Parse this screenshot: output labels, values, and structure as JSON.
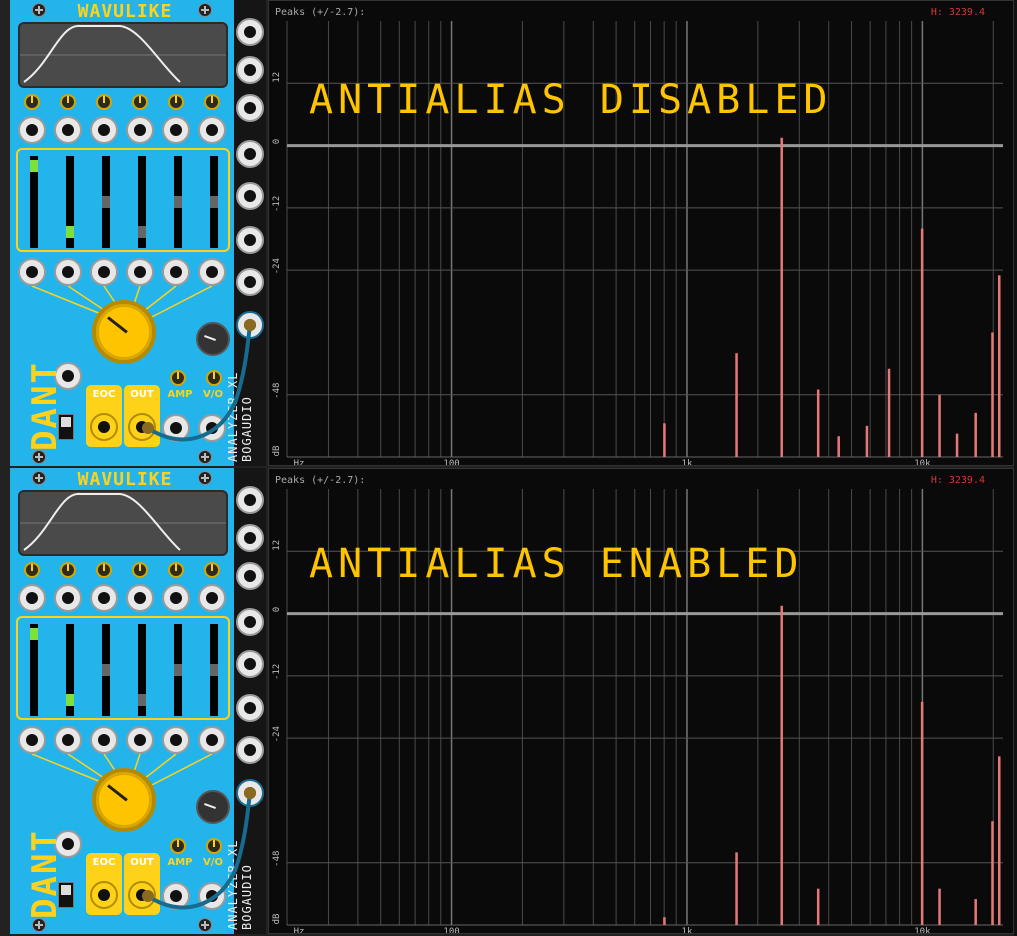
{
  "racks": [
    {
      "wavulike": {
        "title": "WAVULIKE",
        "brand": "DANT",
        "labels": {
          "eoc": "EOC",
          "out": "OUT",
          "amp": "AMP",
          "voct": "V/O"
        },
        "slider_levels": [
          0.05,
          0.88,
          0.5,
          0.88,
          0.5,
          0.5
        ]
      },
      "analyzer": {
        "module_name": "ANALYZER-XL",
        "maker": "BOGAUDIO",
        "header": "Peaks (+/-2.7):",
        "hval": "H: 3239.4",
        "overlay": "ANTIALIAS DISABLED",
        "db_ticks": [
          "12",
          "0",
          "-12",
          "-24",
          "-48",
          "dB"
        ],
        "freq_ticks": [
          "Hz",
          "100",
          "1k",
          "10k"
        ]
      }
    },
    {
      "wavulike": {
        "title": "WAVULIKE",
        "brand": "DANT",
        "labels": {
          "eoc": "EOC",
          "out": "OUT",
          "amp": "AMP",
          "voct": "V/O"
        },
        "slider_levels": [
          0.05,
          0.88,
          0.5,
          0.88,
          0.5,
          0.5
        ]
      },
      "analyzer": {
        "module_name": "ANALYZER-XL",
        "maker": "BOGAUDIO",
        "header": "Peaks (+/-2.7):",
        "hval": "H: 3239.4",
        "overlay": "ANTIALIAS ENABLED",
        "db_ticks": [
          "12",
          "0",
          "-12",
          "-24",
          "-48",
          "dB"
        ],
        "freq_ticks": [
          "Hz",
          "100",
          "1k",
          "10k"
        ]
      }
    }
  ],
  "chart_data": [
    {
      "type": "bar",
      "xscale": "log",
      "xlim": [
        20,
        22000
      ],
      "ylim": [
        -60,
        24
      ],
      "bars": [
        {
          "freq": 800,
          "db": -53.5
        },
        {
          "freq": 1620,
          "db": -40
        },
        {
          "freq": 2520,
          "db": 1.5
        },
        {
          "freq": 3600,
          "db": -47
        },
        {
          "freq": 4400,
          "db": -56
        },
        {
          "freq": 5800,
          "db": -54
        },
        {
          "freq": 7200,
          "db": -43
        },
        {
          "freq": 9950,
          "db": -16
        },
        {
          "freq": 11800,
          "db": -48
        },
        {
          "freq": 14000,
          "db": -55.5
        },
        {
          "freq": 16800,
          "db": -51.5
        },
        {
          "freq": 19800,
          "db": -36
        },
        {
          "freq": 21200,
          "db": -25
        },
        {
          "freq": 23000,
          "db": -49
        },
        {
          "freq": 25000,
          "db": -57
        },
        {
          "freq": 28000,
          "db": -50.5
        },
        {
          "freq": 31000,
          "db": -33.5
        }
      ]
    },
    {
      "type": "bar",
      "xscale": "log",
      "xlim": [
        20,
        22000
      ],
      "ylim": [
        -60,
        24
      ],
      "bars": [
        {
          "freq": 800,
          "db": -58.5
        },
        {
          "freq": 1620,
          "db": -46
        },
        {
          "freq": 2520,
          "db": 1.5
        },
        {
          "freq": 3600,
          "db": -53
        },
        {
          "freq": 9950,
          "db": -17
        },
        {
          "freq": 11800,
          "db": -53
        },
        {
          "freq": 16800,
          "db": -55
        },
        {
          "freq": 19800,
          "db": -40
        },
        {
          "freq": 21200,
          "db": -27.5
        },
        {
          "freq": 23000,
          "db": -52.5
        },
        {
          "freq": 31000,
          "db": -39.5
        }
      ]
    }
  ],
  "colors": {
    "panel": "#24b4ec",
    "accent": "#ffd21a",
    "bar": "#e87878",
    "display_bg": "#0a0a0a"
  }
}
